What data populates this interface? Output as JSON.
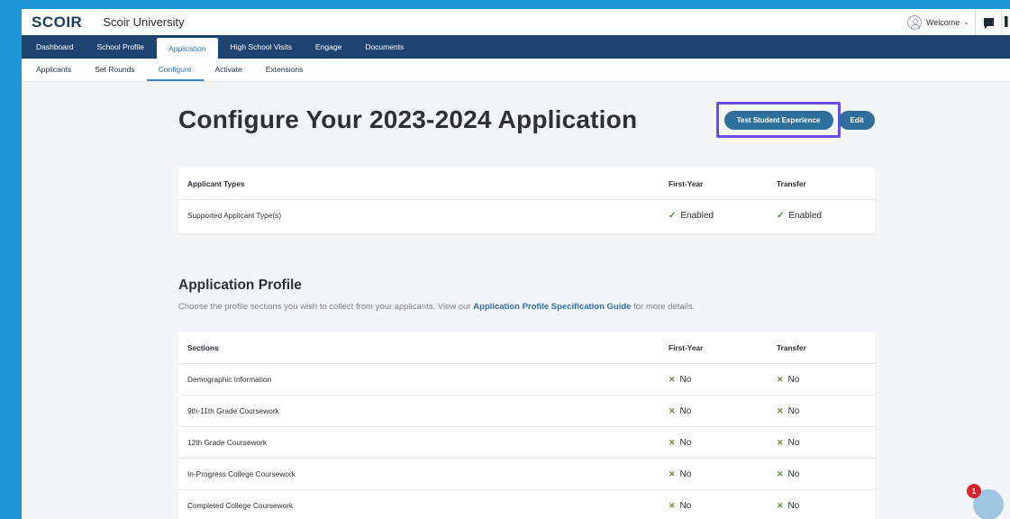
{
  "header": {
    "logo": "SCOIR",
    "university": "Scoir University",
    "welcome": "Welcome",
    "chevron": "⌄"
  },
  "main_nav": [
    {
      "label": "Dashboard",
      "active": false
    },
    {
      "label": "School Profile",
      "active": false
    },
    {
      "label": "Application",
      "active": true
    },
    {
      "label": "High School Visits",
      "active": false
    },
    {
      "label": "Engage",
      "active": false
    },
    {
      "label": "Documents",
      "active": false
    }
  ],
  "sub_nav": [
    {
      "label": "Applicants",
      "active": false
    },
    {
      "label": "Set Rounds",
      "active": false
    },
    {
      "label": "Configure",
      "active": true
    },
    {
      "label": "Activate",
      "active": false
    },
    {
      "label": "Extensions",
      "active": false
    }
  ],
  "page": {
    "title": "Configure Your 2023-2024 Application",
    "test_button": "Test Student Experience",
    "edit_button": "Edit"
  },
  "applicant_types": {
    "headers": [
      "Applicant Types",
      "First-Year",
      "Transfer"
    ],
    "rows": [
      {
        "name": "Supported Applicant Type(s)",
        "first_year": "Enabled",
        "transfer": "Enabled"
      }
    ]
  },
  "profile": {
    "heading": "Application Profile",
    "desc_before": "Choose the profile sections you wish to collect from your applicants. View our ",
    "desc_link": "Application Profile Specification Guide",
    "desc_after": " for more details."
  },
  "sections": {
    "headers": [
      "Sections",
      "First-Year",
      "Transfer"
    ],
    "rows": [
      {
        "name": "Demographic Information",
        "first_year": "No",
        "transfer": "No"
      },
      {
        "name": "9th-11th Grade Coursework",
        "first_year": "No",
        "transfer": "No"
      },
      {
        "name": "12th Grade Coursework",
        "first_year": "No",
        "transfer": "No"
      },
      {
        "name": "In-Progress College Coursework",
        "first_year": "No",
        "transfer": "No"
      },
      {
        "name": "Completed College Coursework",
        "first_year": "No",
        "transfer": "No"
      }
    ]
  },
  "support": {
    "notification_count": "1"
  },
  "colors": {
    "frame_blue": "#1b95d3",
    "nav_navy": "#1d4470",
    "button_blue": "#2f6f9c",
    "highlight_purple": "#6b4bea",
    "check_green": "#4f8a2c",
    "badge_red": "#d9232e"
  },
  "icons": {
    "avatar": "user-avatar-icon",
    "chat": "chat-icon",
    "enabled": "checkmark-icon",
    "disabled": "x-mark-icon",
    "support": "support-chat-icon"
  }
}
